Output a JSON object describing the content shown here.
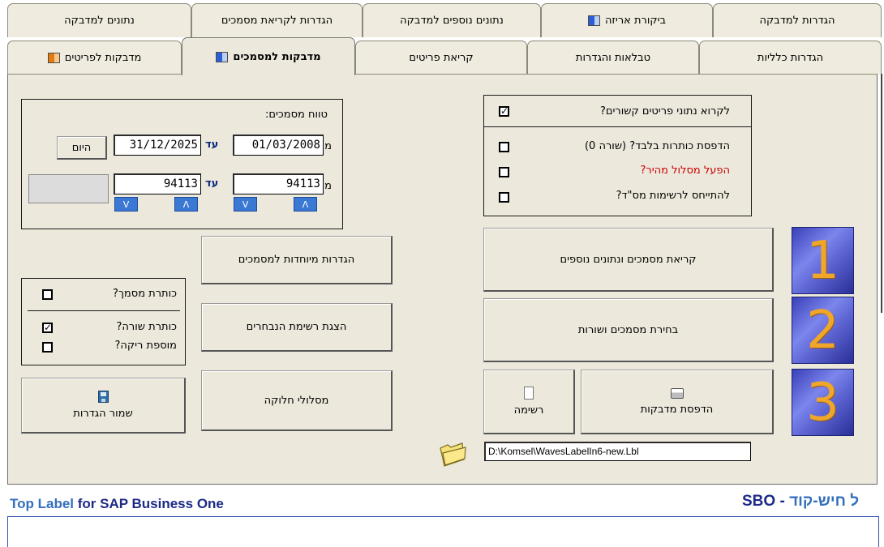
{
  "tabs_row1": [
    {
      "label": "הגדרות למדבקה"
    },
    {
      "label": "ביקורת אריזה",
      "flag": "blue"
    },
    {
      "label": "נתונים נוספים למדבקה"
    },
    {
      "label": "הגדרות לקריאת מסמכים"
    },
    {
      "label": "נתונים למדבקה"
    }
  ],
  "tabs_row2": [
    {
      "label": "הגדרות כלליות"
    },
    {
      "label": "טבלאות והגדרות"
    },
    {
      "label": "קריאת פריטים"
    },
    {
      "label": "מדבקות למסמכים",
      "flag": "blue",
      "active": true
    },
    {
      "label": "מדבקות לפריטים",
      "flag": "orange"
    }
  ],
  "range": {
    "title": "טווח מסמכים:",
    "from_date_label": "מתאריך:",
    "from_date": "01/03/2008",
    "to_label": "עד",
    "to_date": "31/12/2025",
    "today_button": "היום",
    "from_number_label": "ממספר:",
    "from_number": "94113",
    "to_number": "94113",
    "spin_down": "V",
    "spin_up": "Λ"
  },
  "options": {
    "read_linked": "לקרוא נתוני פריטים קשורים?",
    "read_linked_checked": true,
    "headers_only": "הדפסת כותרות בלבד? (שורה 0)",
    "fast_path": "הפעל מסלול מהיר?",
    "refer_list": "להתייחס לרשימות מס\"ד?"
  },
  "header_opts": {
    "doc_header": "כותרת מסמך?",
    "row_header": "כותרת שורה?",
    "row_header_checked": true,
    "empty_add": "מוספת ריקה?"
  },
  "buttons": {
    "special_settings": "הגדרות מיוחדות למסמכים",
    "show_selected": "הצגת רשימת הנבחרים",
    "distribution": "מסלולי חלוקה",
    "save_settings": "שמור הגדרות",
    "read_docs": "קריאת מסמכים ונתונים נוספים",
    "select_docs": "בחירת מסמכים ושורות",
    "print_labels": "הדפסת מדבקות",
    "list": "רשימה"
  },
  "steps": [
    "1",
    "2",
    "3"
  ],
  "file_path": "D:\\Komsel\\WavesLabelIn6-new.Lbl",
  "footer": {
    "product": "Top Label",
    "for_text": "for SAP Business One",
    "right_latin": "SBO - ",
    "right_hebrew": "ל חיש-קוד"
  },
  "colors": {
    "fast_path_text": "#cc0000",
    "accent_blue": "#1d2a86"
  }
}
